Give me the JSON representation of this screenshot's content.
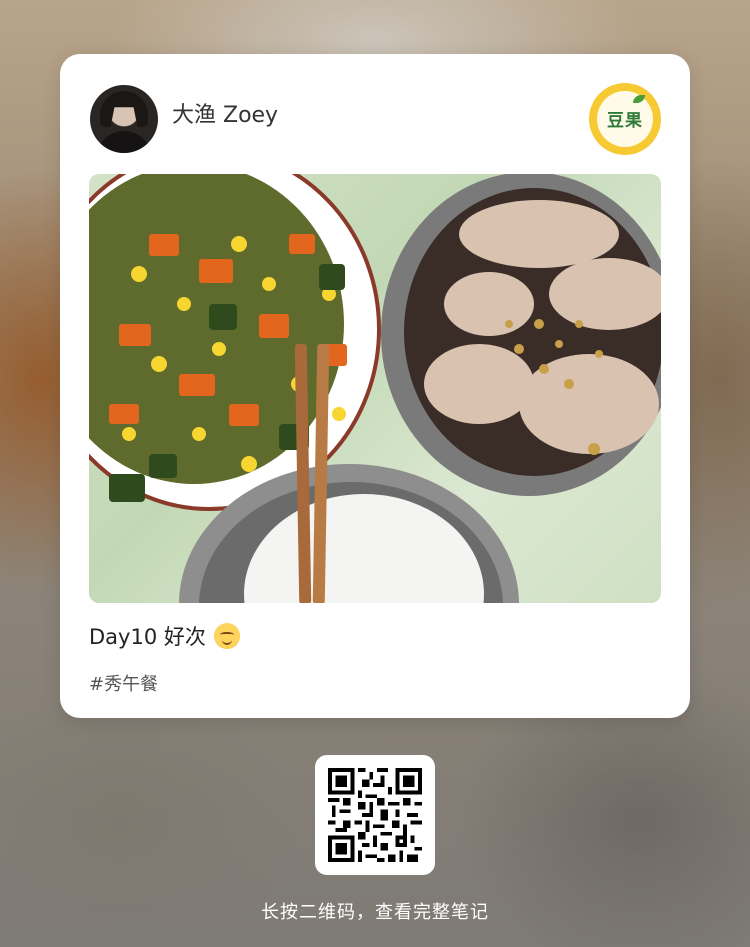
{
  "post": {
    "author_name": "大渔 Zoey",
    "brand_logo_text": "豆果",
    "caption": "Day10 好次",
    "caption_emoji": "relieved-face-emoji",
    "hashtag": "#秀午餐"
  },
  "photo": {
    "description_icon": "food-photo",
    "dishes": [
      "vegetable-stir-fry",
      "steamed-dumplings",
      "rice-bowl"
    ]
  },
  "share": {
    "qr_icon": "qr-code-icon",
    "hint": "长按二维码，查看完整笔记"
  },
  "colors": {
    "brand_yellow": "#f7c933",
    "brand_green": "#2f7a3a",
    "card_bg": "#ffffff"
  }
}
